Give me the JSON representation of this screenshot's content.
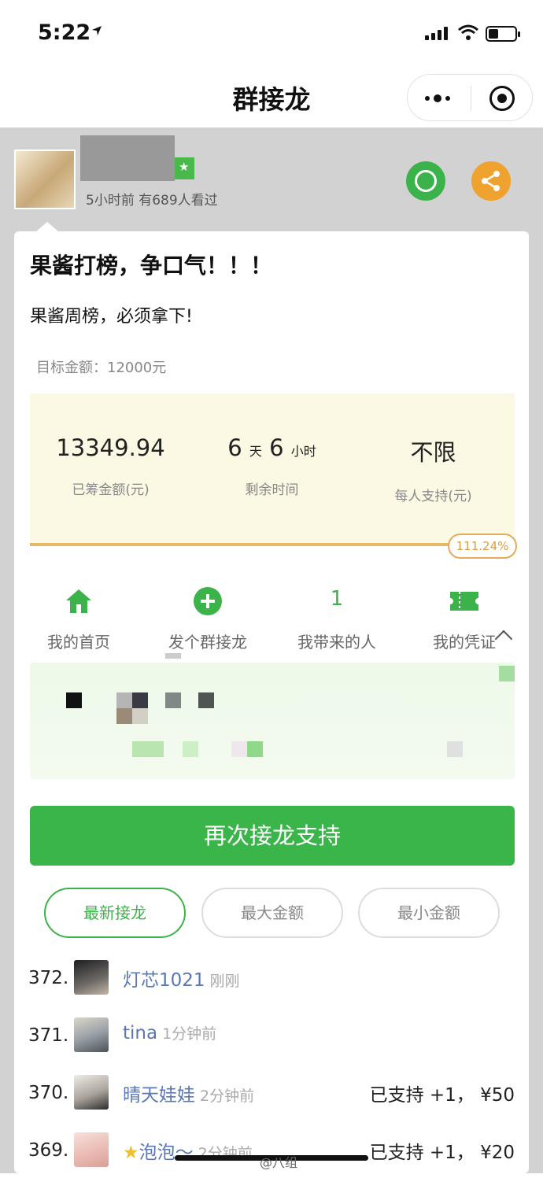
{
  "status_bar": {
    "time": "5:22"
  },
  "navbar": {
    "title": "群接龙"
  },
  "post": {
    "meta": "5小时前   有689人看过",
    "title": "果酱打榜，争口气！！！",
    "description": "果酱周榜，必须拿下!",
    "target_amount": "目标金额：12000元"
  },
  "stats": {
    "raised_value": "13349.94",
    "raised_label": "已筹金额(元)",
    "days": "6",
    "days_unit": "天",
    "hours": "6",
    "hours_unit": "小时",
    "remaining_label": "剩余时间",
    "limit_value": "不限",
    "limit_label": "每人支持(元)",
    "progress_text": "111.24%",
    "progress_fraction": 1.1124
  },
  "actions": [
    {
      "label": "我的首页",
      "icon": "home-icon"
    },
    {
      "label": "发个群接龙",
      "icon": "plus-circle-icon"
    },
    {
      "label": "我带来的人",
      "count": "1"
    },
    {
      "label": "我的凭证",
      "icon": "ticket-icon"
    }
  ],
  "support_button": "再次接龙支持",
  "filters": [
    "最新接龙",
    "最大金额",
    "最小金额"
  ],
  "entries": [
    {
      "no": "372.",
      "name": "灯芯1021",
      "time": "刚刚",
      "support": ""
    },
    {
      "no": "371.",
      "name": "tina",
      "time": "1分钟前",
      "support": ""
    },
    {
      "no": "370.",
      "name": "晴天娃娃",
      "time": "2分钟前",
      "support": "已支持 +1，  ¥50"
    },
    {
      "no": "369.",
      "name": "泡泡～",
      "time": "2分钟前",
      "support": "已支持 +1，  ¥20"
    }
  ],
  "watermark": "@八组",
  "colors": {
    "green": "#3cb34a",
    "orange": "#f0a22e",
    "progress": "#e7b86a",
    "link": "#5a78b5"
  }
}
